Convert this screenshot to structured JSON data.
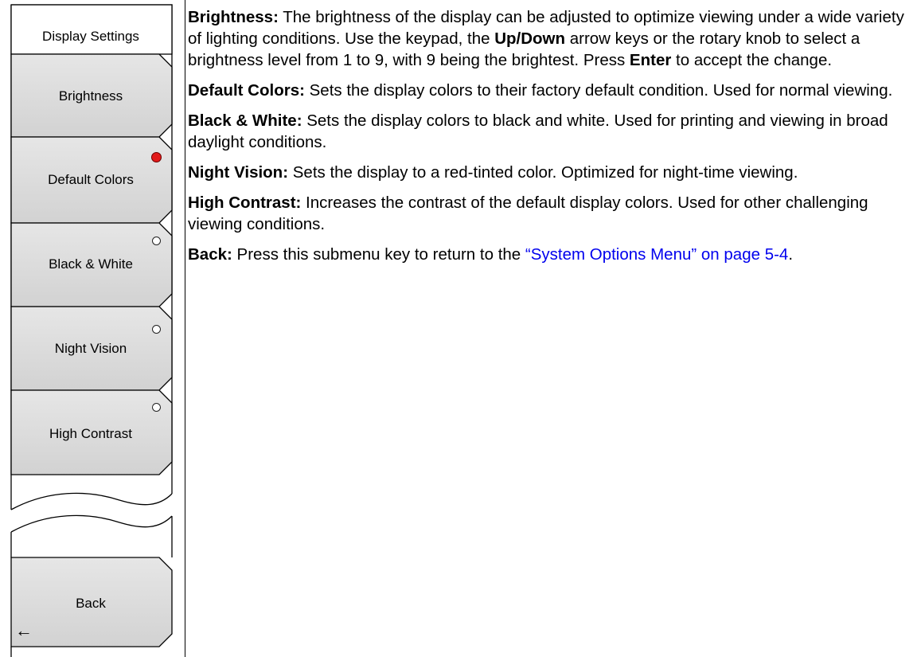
{
  "menu": {
    "title": "Display Settings",
    "keys": [
      {
        "label": "Brightness"
      },
      {
        "label": "Default Colors",
        "selected": true
      },
      {
        "label": "Black & White",
        "selected": false
      },
      {
        "label": "Night Vision",
        "selected": false
      },
      {
        "label": "High Contrast",
        "selected": false
      }
    ],
    "back": {
      "label": "Back",
      "arrow_glyph": "←",
      "icon": "left-arrow-icon"
    },
    "colors": {
      "key_fill": "#d9d9d9",
      "radio_selected": "#e21a1a"
    }
  },
  "descriptions": {
    "brightness": {
      "term": "Brightness:",
      "t1": " The brightness of the display can be adjusted to optimize viewing under a wide variety of lighting conditions. Use the keypad, the ",
      "b1": "Up/Down",
      "t2": " arrow keys or the rotary knob to select a brightness level from 1 to 9, with 9 being the brightest. Press ",
      "b2": "Enter",
      "t3": " to accept the change."
    },
    "default_colors": {
      "term": "Default Colors:",
      "text": " Sets the display colors to their factory default condition. Used for normal viewing."
    },
    "black_white": {
      "term": "Black & White:",
      "text": " Sets the display colors to black and white. Used for printing and viewing in broad daylight conditions."
    },
    "night_vision": {
      "term": "Night Vision:",
      "text": " Sets the display to a red-tinted color. Optimized for night-time viewing."
    },
    "high_contrast": {
      "term": "High Contrast:",
      "text": " Increases the contrast of the default display colors. Used for other challenging viewing conditions."
    },
    "back": {
      "term": "Back:",
      "text": " Press this submenu key to return to the ",
      "link": "“System Options Menu” on page 5-4",
      "tail": "."
    }
  }
}
